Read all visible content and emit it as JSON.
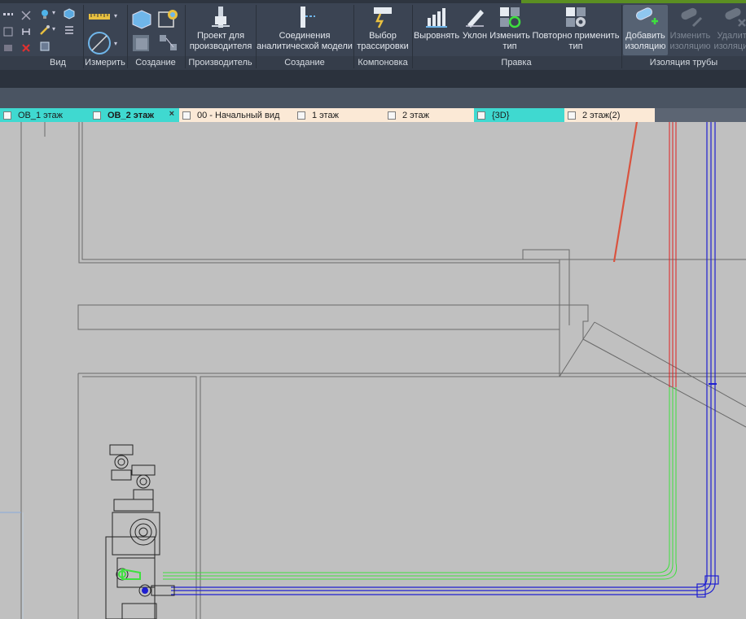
{
  "ribbon": {
    "panels": {
      "view": "Вид",
      "measure": "Измерить",
      "create": "Создание",
      "manufacturer": "Производитель",
      "create2": "Создание",
      "layout": "Компоновка",
      "edit": "Правка",
      "insulation": "Изоляция трубы"
    },
    "tools": {
      "manufacturer_project": "Проект для\nпроизводителя",
      "analytical_connections": "Соединения\nаналитической модели",
      "route_selection": "Выбор\nтрассировки",
      "align": "Выровнять",
      "slope": "Уклон",
      "change_type": "Изменить\nтип",
      "reapply_type": "Повторно применить\nтип",
      "add_insulation": "Добавить\nизоляцию",
      "edit_insulation": "Изменить\nизоляцию",
      "remove_insulation": "Удалить\nизоляцию"
    }
  },
  "tabs": [
    {
      "label": "ОВ_1 этаж"
    },
    {
      "label": "ОВ_2 этаж"
    },
    {
      "label": "00 - Начальный вид"
    },
    {
      "label": "1 этаж"
    },
    {
      "label": "2 этаж"
    },
    {
      "label": "{3D}"
    },
    {
      "label": "2 этаж(2)"
    }
  ],
  "colors": {
    "ribbon": "#3b4453",
    "canvas": "#c0c0c0",
    "tab_active": "#3fd9d0",
    "tab_inactive": "#fbe9d6",
    "pipe_blue": "#1f1fd0",
    "pipe_red": "#e02020",
    "pipe_green": "#3ee03e",
    "arrow": "#d9533f"
  }
}
